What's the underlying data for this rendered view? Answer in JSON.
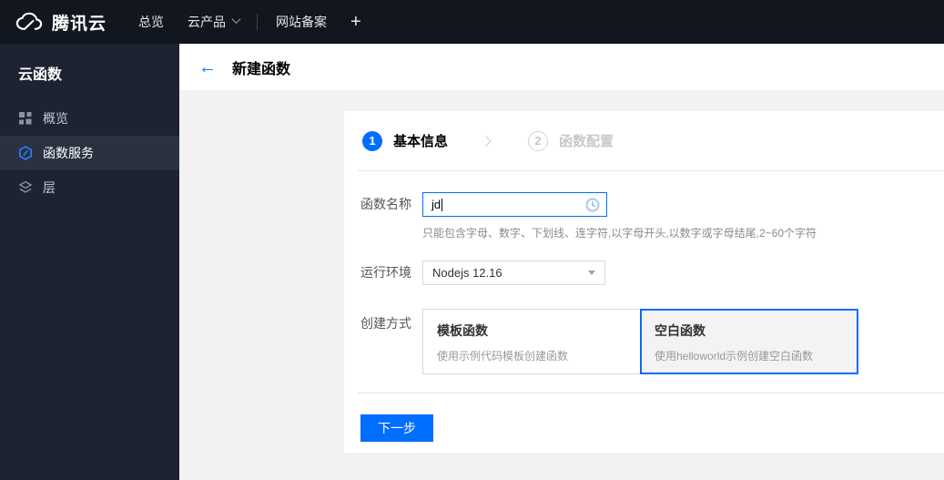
{
  "topnav": {
    "brand": "腾讯云",
    "overview": "总览",
    "products": "云产品",
    "beian": "网站备案",
    "plus": "+"
  },
  "sidebar": {
    "title": "云函数",
    "items": [
      {
        "label": "概览",
        "icon": "grid-icon",
        "selected": false
      },
      {
        "label": "函数服务",
        "icon": "function-hexagon-icon",
        "selected": true
      },
      {
        "label": "层",
        "icon": "layers-icon",
        "selected": false
      }
    ]
  },
  "header": {
    "back": "←",
    "title": "新建函数"
  },
  "wizard": {
    "steps": [
      {
        "num": "1",
        "label": "基本信息",
        "active": true
      },
      {
        "num": "2",
        "label": "函数配置",
        "active": false
      }
    ]
  },
  "form": {
    "name_label": "函数名称",
    "name_value": "jd",
    "name_help": "只能包含字母、数字、下划线、连字符,以字母开头,以数字或字母结尾,2~60个字符",
    "runtime_label": "运行环境",
    "runtime_value": "Nodejs 12.16",
    "method_label": "创建方式",
    "methods": [
      {
        "title": "模板函数",
        "desc": "使用示例代码模板创建函数",
        "selected": false
      },
      {
        "title": "空白函数",
        "desc": "使用helloworld示例创建空白函数",
        "selected": true
      }
    ]
  },
  "actions": {
    "next": "下一步"
  },
  "colors": {
    "brand_blue": "#006eff",
    "topnav_bg": "#12161f",
    "sidebar_bg": "#1d2330",
    "sidebar_selected_bg": "#2a3140",
    "content_bg": "#f2f2f2",
    "selected_card_bg": "#f3f3f3",
    "clock_icon_blue": "#9ec4f8"
  }
}
